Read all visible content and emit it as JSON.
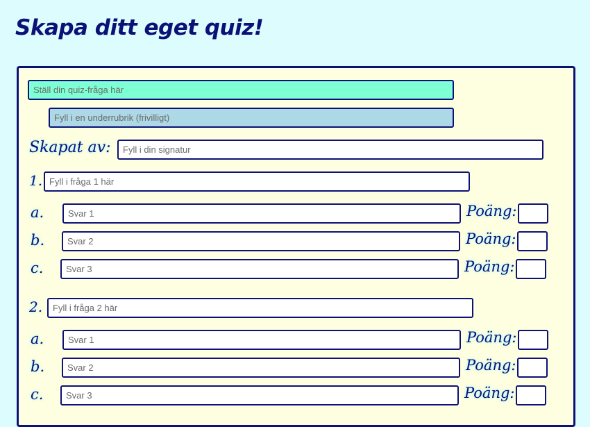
{
  "header": {
    "title": "Skapa ditt eget quiz!"
  },
  "form": {
    "title_placeholder": "Ställ din quiz-fråga här",
    "subtitle_placeholder": "Fyll i en underrubrik (frivilligt)",
    "created_by_label": "Skapat av:",
    "signature_placeholder": "Fyll i din signatur",
    "points_label": "Poäng:",
    "questions": [
      {
        "number": "1.",
        "placeholder": "Fyll i fråga 1 här",
        "answers": [
          {
            "letter": "a.",
            "placeholder": "Svar 1"
          },
          {
            "letter": "b.",
            "placeholder": "Svar 2"
          },
          {
            "letter": "c.",
            "placeholder": "Svar 3"
          }
        ]
      },
      {
        "number": "2.",
        "placeholder": "Fyll i fråga 2 här",
        "answers": [
          {
            "letter": "a.",
            "placeholder": "Svar 1"
          },
          {
            "letter": "b.",
            "placeholder": "Svar 2"
          },
          {
            "letter": "c.",
            "placeholder": "Svar 3"
          }
        ]
      }
    ]
  },
  "colors": {
    "background": "#dcfcfd",
    "panel": "#fefee0",
    "accent": "#0c1177",
    "title_input": "#7fffd4",
    "subtitle_input": "#add8e6"
  }
}
